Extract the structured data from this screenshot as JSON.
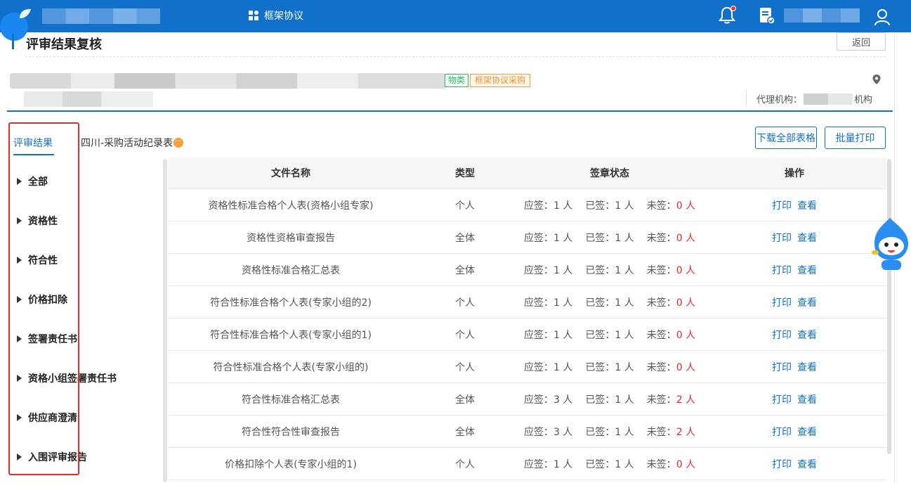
{
  "topbar": {
    "nav_label": "框架协议"
  },
  "page": {
    "title": "评审结果复核",
    "return_label": "返回"
  },
  "tags": {
    "category": "物类",
    "method": "框架协议采购"
  },
  "agency": {
    "prefix": "代理机构：",
    "suffix": "机构"
  },
  "tabs": [
    {
      "label": "评审结果"
    },
    {
      "label": "四川-采购活动纪录表"
    }
  ],
  "tab_badge": "···",
  "actions": {
    "download_all": "下载全部表格",
    "batch_print": "批量打印"
  },
  "tree": [
    {
      "label": "全部"
    },
    {
      "label": "资格性"
    },
    {
      "label": "符合性"
    },
    {
      "label": "价格扣除"
    },
    {
      "label": "签署责任书"
    },
    {
      "label": "资格小组签署责任书"
    },
    {
      "label": "供应商澄清"
    },
    {
      "label": "入围评审报告"
    }
  ],
  "table": {
    "headers": {
      "name": "文件名称",
      "type": "类型",
      "status": "签章状态",
      "ops": "操作"
    },
    "labels": {
      "should": "应签：",
      "signed": "已签：",
      "unsigned": "未签：",
      "unit": " 人",
      "print": "打印",
      "view": "查看"
    },
    "rows": [
      {
        "name": "资格性标准合格个人表(资格小组专家)",
        "type": "个人",
        "should": "1",
        "signed": "1",
        "unsigned": "0"
      },
      {
        "name": "资格性资格审查报告",
        "type": "全体",
        "should": "1",
        "signed": "1",
        "unsigned": "0"
      },
      {
        "name": "资格性标准合格汇总表",
        "type": "全体",
        "should": "1",
        "signed": "1",
        "unsigned": "0"
      },
      {
        "name": "符合性标准合格个人表(专家小组的2)",
        "type": "个人",
        "should": "1",
        "signed": "1",
        "unsigned": "0"
      },
      {
        "name": "符合性标准合格个人表(专家小组的1)",
        "type": "个人",
        "should": "1",
        "signed": "1",
        "unsigned": "0"
      },
      {
        "name": "符合性标准合格个人表(专家小组的)",
        "type": "个人",
        "should": "1",
        "signed": "1",
        "unsigned": "0"
      },
      {
        "name": "符合性标准合格汇总表",
        "type": "全体",
        "should": "3",
        "signed": "1",
        "unsigned": "2"
      },
      {
        "name": "符合性符合性审查报告",
        "type": "全体",
        "should": "3",
        "signed": "1",
        "unsigned": "2"
      },
      {
        "name": "价格扣除个人表(专家小组的1)",
        "type": "个人",
        "should": "1",
        "signed": "1",
        "unsigned": "0"
      }
    ]
  },
  "colors": {
    "primary": "#1170c9",
    "danger": "#e32a2a",
    "tag_green": "#39b36b",
    "tag_orange": "#f0902c"
  },
  "icons": [
    "grid-icon",
    "bell-icon",
    "document-icon",
    "user-icon",
    "location-pin-icon",
    "mascot-icon"
  ]
}
